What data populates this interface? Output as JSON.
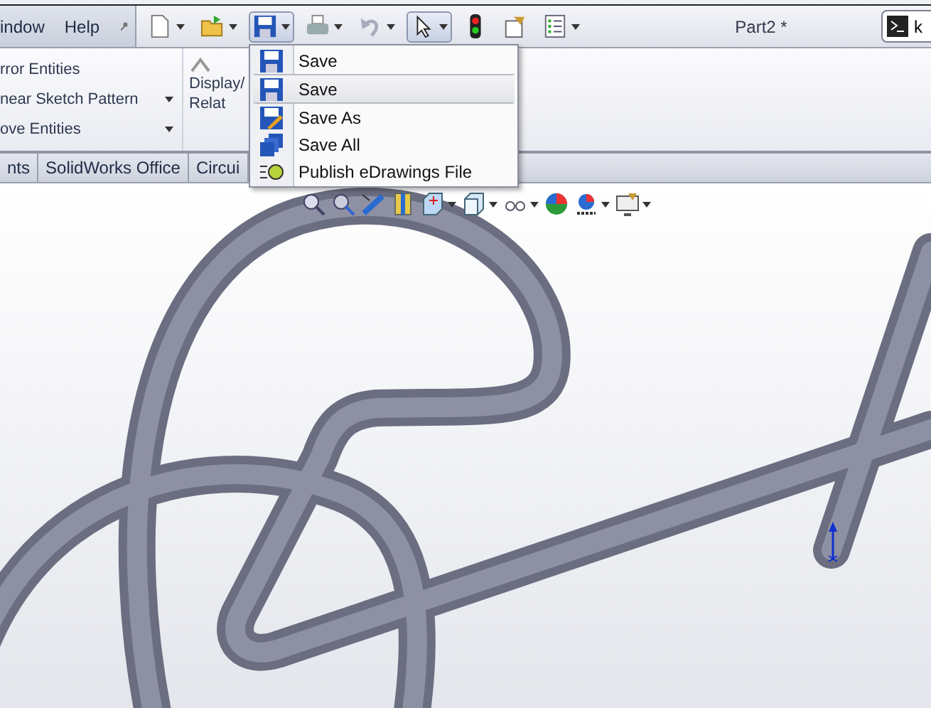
{
  "menubar": [
    {
      "label": "indow"
    },
    {
      "label": "Help"
    }
  ],
  "toolbar": [
    {
      "kind": "new",
      "caret": true,
      "pressed": false
    },
    {
      "kind": "open",
      "caret": true,
      "pressed": false
    },
    {
      "kind": "save",
      "caret": true,
      "pressed": true
    },
    {
      "kind": "print",
      "caret": true,
      "pressed": false
    },
    {
      "kind": "undo",
      "caret": true,
      "pressed": false
    },
    {
      "kind": "select",
      "caret": true,
      "pressed": true
    },
    {
      "kind": "light",
      "caret": false,
      "pressed": false
    },
    {
      "kind": "options",
      "caret": false,
      "pressed": false
    },
    {
      "kind": "list",
      "caret": true,
      "pressed": false
    }
  ],
  "document_title": "Part2 *",
  "search": {
    "value": "k"
  },
  "ribbon": {
    "commands": [
      {
        "label": "rror Entities",
        "caret": false
      },
      {
        "label": "near Sketch Pattern",
        "caret": true
      },
      {
        "label": "ove Entities",
        "caret": true
      }
    ],
    "display_button": {
      "lines": [
        "Display/",
        "Relat"
      ]
    }
  },
  "tabs": [
    {
      "label": "nts",
      "selected": false
    },
    {
      "label": "SolidWorks Office",
      "selected": false
    },
    {
      "label": "Circui",
      "selected": false
    }
  ],
  "save_menu": [
    {
      "label": "Save",
      "kind": "save",
      "selected": false,
      "separator_after": true
    },
    {
      "label": "Save",
      "kind": "save",
      "selected": true,
      "separator_after": true
    },
    {
      "label": "Save As",
      "kind": "saveas",
      "selected": false,
      "separator_after": false
    },
    {
      "label": "Save All",
      "kind": "saveall",
      "selected": false,
      "separator_after": false
    },
    {
      "label": "Publish eDrawings File",
      "kind": "edrawings",
      "selected": false,
      "separator_after": false
    }
  ],
  "view_toolbar": [
    {
      "kind": "zoom-fit",
      "caret": false
    },
    {
      "kind": "zoom-area",
      "caret": false
    },
    {
      "kind": "previous",
      "caret": false
    },
    {
      "kind": "section",
      "caret": false
    },
    {
      "kind": "orientation",
      "caret": true
    },
    {
      "kind": "display",
      "caret": true
    },
    {
      "kind": "hide",
      "caret": true
    },
    {
      "kind": "appearance",
      "caret": false
    },
    {
      "kind": "scene",
      "caret": true
    },
    {
      "kind": "settings",
      "caret": true
    }
  ]
}
